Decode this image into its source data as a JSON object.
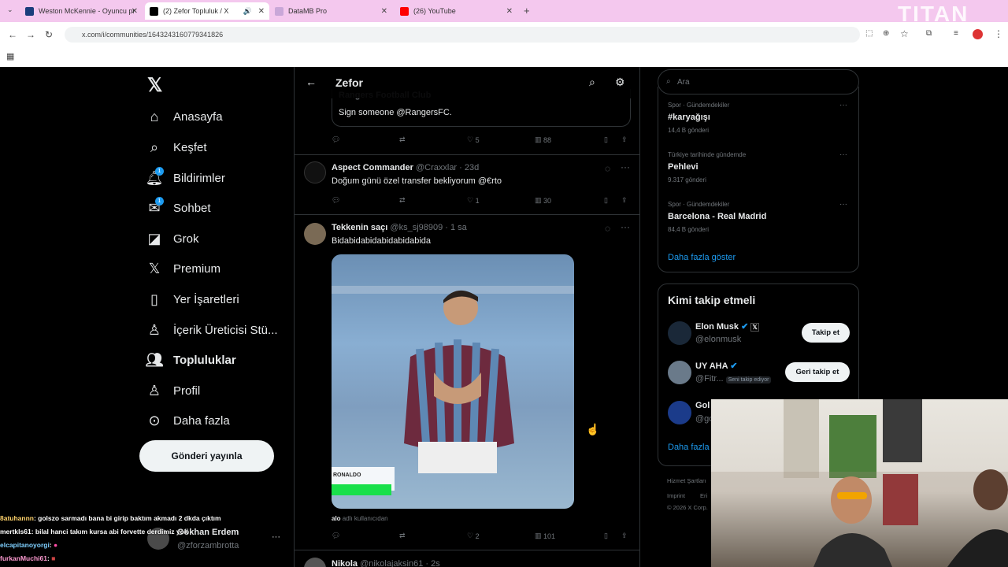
{
  "browser": {
    "tabs": [
      {
        "title": "Weston McKennie - Oyuncu pr",
        "fav_color": "#1a3d7c"
      },
      {
        "title": "(2) Zefor Topluluk / X",
        "fav_color": "#000000"
      },
      {
        "title": "DataMB Pro",
        "fav_color": "#c9a7d8"
      },
      {
        "title": "(26) YouTube",
        "fav_color": "#ff0000"
      }
    ],
    "url": "x.com/i/communities/1643243160779341826",
    "watermark": "TITAN"
  },
  "nav": {
    "items": [
      {
        "label": "Anasayfa",
        "icon": "home-icon"
      },
      {
        "label": "Keşfet",
        "icon": "search-icon"
      },
      {
        "label": "Bildirimler",
        "icon": "bell-icon",
        "badge": "1"
      },
      {
        "label": "Sohbet",
        "icon": "mail-icon",
        "badge": "1"
      },
      {
        "label": "Grok",
        "icon": "grok-icon"
      },
      {
        "label": "Premium",
        "icon": "x-icon"
      },
      {
        "label": "Yer İşaretleri",
        "icon": "bookmark-icon"
      },
      {
        "label": "İçerik Üreticisi Stü...",
        "icon": "creator-icon"
      },
      {
        "label": "Topluluklar",
        "icon": "communities-icon"
      },
      {
        "label": "Profil",
        "icon": "user-icon"
      },
      {
        "label": "Daha fazla",
        "icon": "more-circle-icon"
      }
    ],
    "post_button": "Gönderi yayınla",
    "account_name": "Gökhan Erdem",
    "account_handle": "@zforzambrotta"
  },
  "header": {
    "title": "Zefor"
  },
  "feed": {
    "quoted": {
      "name": "Rangers Football Club",
      "text": "Sign someone @RangersFC."
    },
    "tweet0_actions": {
      "likes": "5",
      "views": "88"
    },
    "tweet1": {
      "name": "Aspect Commander",
      "handle": "@Craxxlar · 23d",
      "text": "Doğum günü özel transfer bekliyorum @€rto",
      "likes": "1",
      "views": "30"
    },
    "tweet2": {
      "name": "Tekkenin saçı",
      "handle": "@ks_sj98909 · 1 sa",
      "text": "Bidabidabidabidabidabida",
      "media_label": "RONALDO",
      "byline_user": "alo",
      "byline_rest": "adlı kullanıcıdan",
      "likes": "2",
      "views": "101"
    },
    "tweet3": {
      "name": "Nikola",
      "handle": "@nikolajaksin61 · 2s"
    }
  },
  "right": {
    "search_placeholder": "Ara",
    "trends": [
      {
        "meta": "Spor · Gündemdekiler",
        "name": "#karyağışı",
        "count": "14,4 B gönderi"
      },
      {
        "meta": "Türkiye tarihinde gündemde",
        "name": "Pehlevi",
        "count": "9.317 gönderi"
      },
      {
        "meta": "Spor · Gündemdekiler",
        "name": "Barcelona - Real Madrid",
        "count": "84,4 B gönderi"
      }
    ],
    "show_more": "Daha fazla göster",
    "who_to_follow": "Kimi takip etmeli",
    "follow": [
      {
        "name": "Elon Musk",
        "handle": "@elonmusk",
        "button": "Takip et"
      },
      {
        "name": "UY AHA",
        "handle": "@Fitr...",
        "tag": "Seni takip ediyor",
        "button": "Geri takip et"
      },
      {
        "name": "Gol",
        "handle": "@go"
      }
    ],
    "follow_more": "Daha fazla",
    "footer": [
      "Hizmet Şartları",
      "Imprint",
      "Eri",
      "© 2026 X Corp."
    ]
  },
  "chat": [
    {
      "user": "8atuhannn",
      "text": ": golszo sarmadı bana bi girip baktım akmadı 2 dkda çıktım",
      "color": "#ffd36b"
    },
    {
      "user": "mertkls61",
      "text": ": bilal hanci takım kursa abi forvette derdimiz yok",
      "color": "#ffffff"
    },
    {
      "user": "elcapitanoyorgi",
      "text": ":",
      "color": "#7fd0ff"
    },
    {
      "user": "furkanMuchi61",
      "text": ":",
      "color": "#ff9bd2"
    }
  ]
}
